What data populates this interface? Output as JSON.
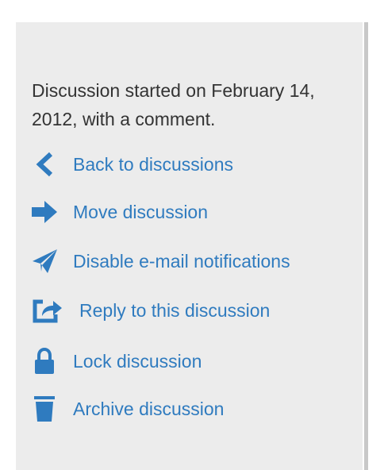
{
  "summary": {
    "text": "Discussion started on February 14, 2012, with a comment."
  },
  "actions": [
    {
      "label": "Back to discussions",
      "icon": "chevron-left-icon"
    },
    {
      "label": "Move discussion",
      "icon": "arrow-right-icon"
    },
    {
      "label": "Disable e-mail notifications",
      "icon": "paper-plane-icon"
    },
    {
      "label": "Reply to this discussion",
      "icon": "share-box-icon"
    },
    {
      "label": "Lock discussion",
      "icon": "lock-icon"
    },
    {
      "label": "Archive discussion",
      "icon": "trash-icon"
    }
  ],
  "colors": {
    "panel_background": "#ececec",
    "link": "#2f7bbf",
    "text": "#333333"
  }
}
